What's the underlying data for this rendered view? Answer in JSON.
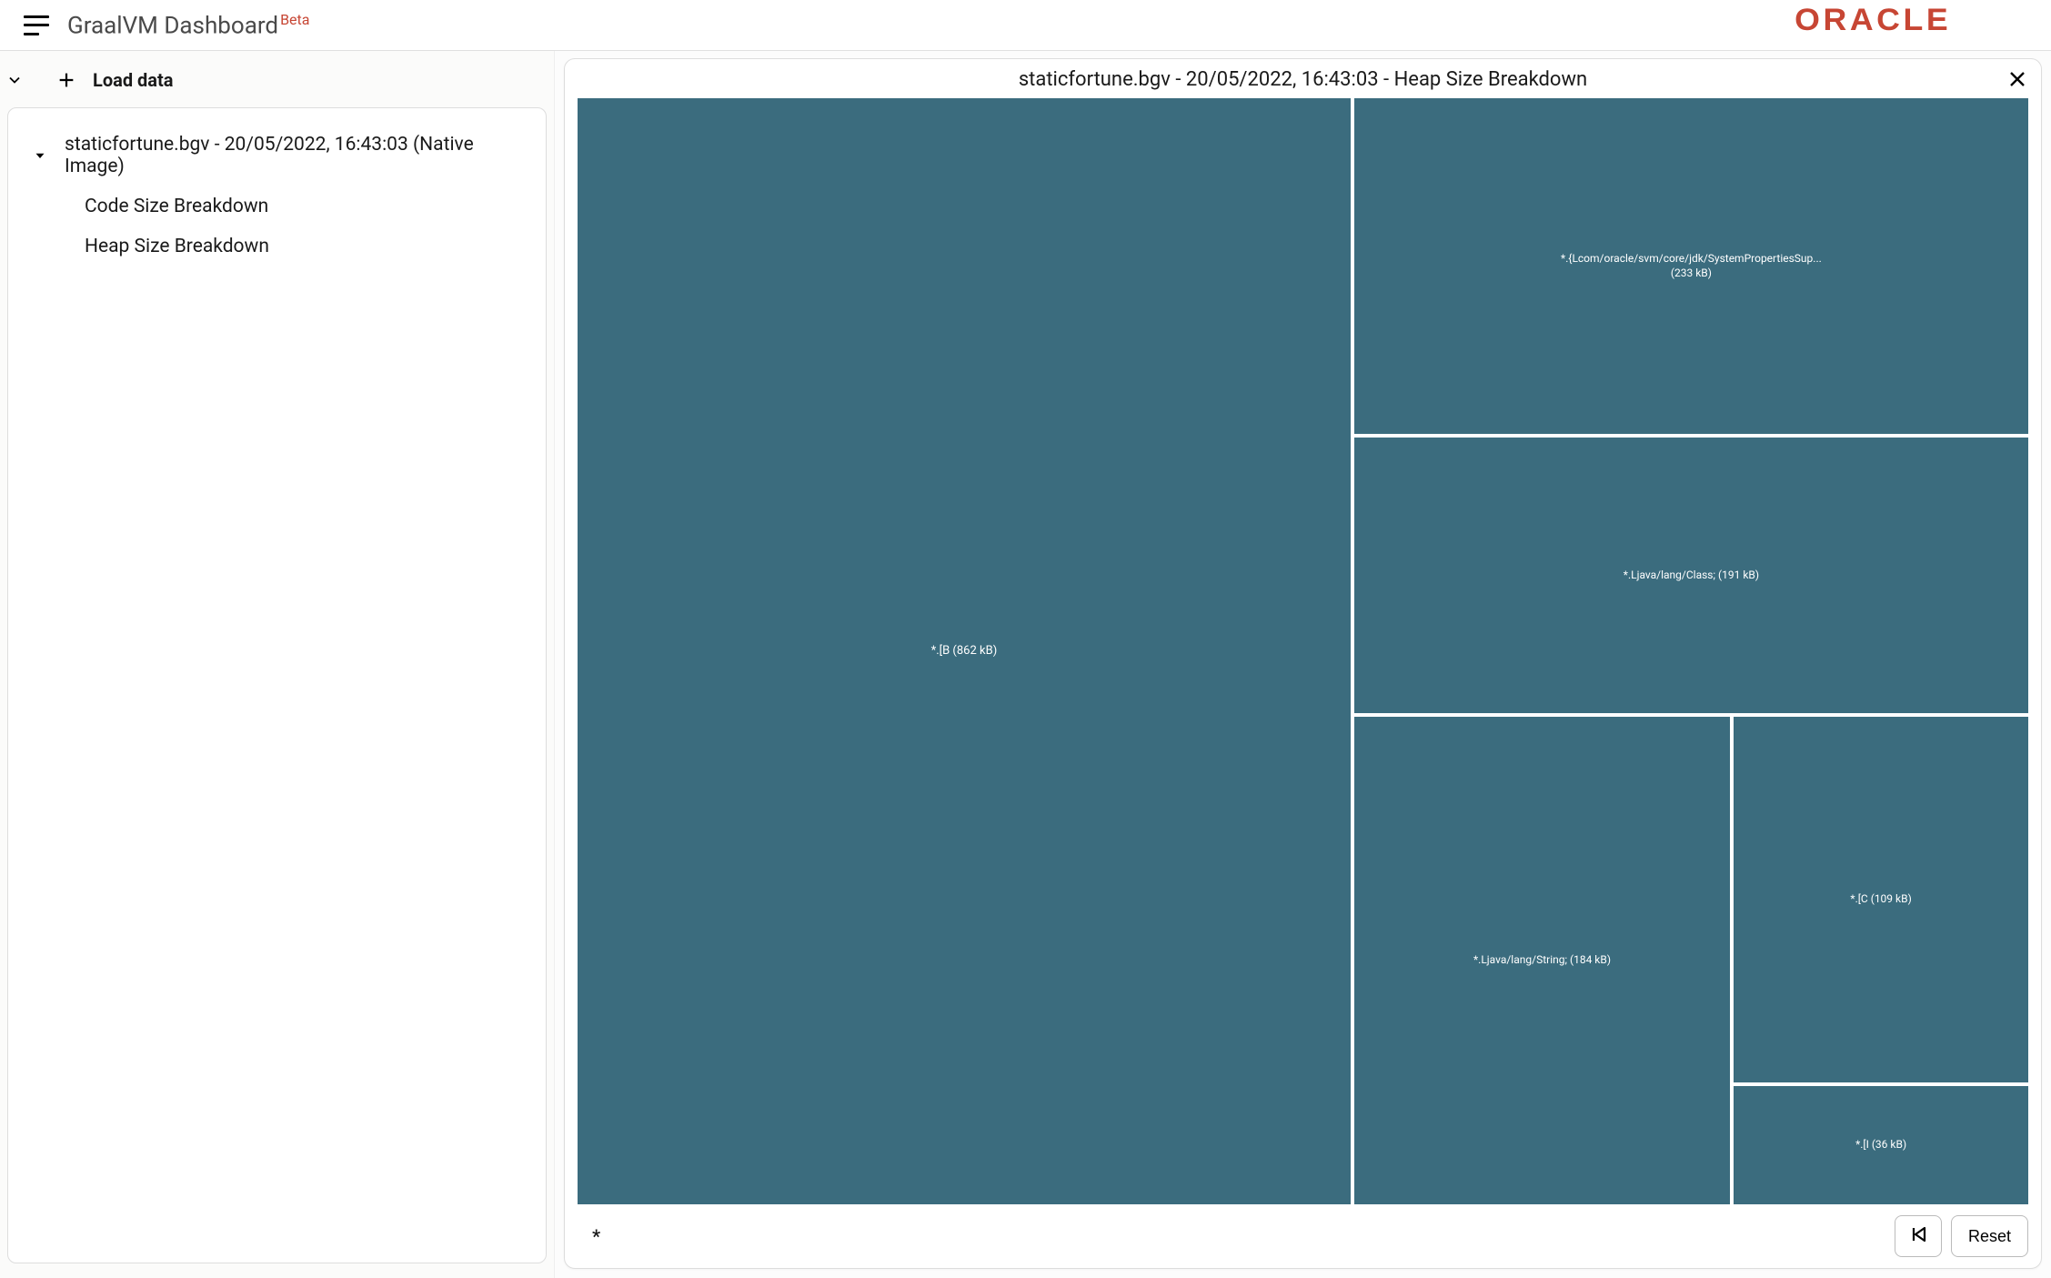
{
  "header": {
    "title": "GraalVM Dashboard",
    "badge": "Beta",
    "brand": "ORACLE"
  },
  "sidebar": {
    "load_label": "Load data",
    "file": {
      "label": "staticfortune.bgv - 20/05/2022, 16:43:03 (Native Image)",
      "children": [
        {
          "label": "Code Size Breakdown"
        },
        {
          "label": "Heap Size Breakdown"
        }
      ]
    }
  },
  "viz": {
    "title": "staticfortune.bgv - 20/05/2022, 16:43:03 - Heap Size Breakdown",
    "breadcrumb": "*",
    "reset_label": "Reset"
  },
  "chart_data": {
    "type": "treemap",
    "unit": "kB",
    "root": "*",
    "nodes": [
      {
        "name": "*.[B",
        "size_kb": 862,
        "label": "*.[B (862 kB)"
      },
      {
        "name": "*.{Lcom/oracle/svm/core/jdk/SystemPropertiesSup...",
        "size_kb": 233,
        "label": "*.{Lcom/oracle/svm/core/jdk/SystemPropertiesSup...\n(233 kB)"
      },
      {
        "name": "*.Ljava/lang/Class;",
        "size_kb": 191,
        "label": "*.Ljava/lang/Class; (191 kB)"
      },
      {
        "name": "*.Ljava/lang/String;",
        "size_kb": 184,
        "label": "*.Ljava/lang/String; (184 kB)"
      },
      {
        "name": "*.[C",
        "size_kb": 109,
        "label": "*.[C (109 kB)"
      },
      {
        "name": "*.[I",
        "size_kb": 36,
        "label": "*.[I (36 kB)"
      }
    ]
  }
}
